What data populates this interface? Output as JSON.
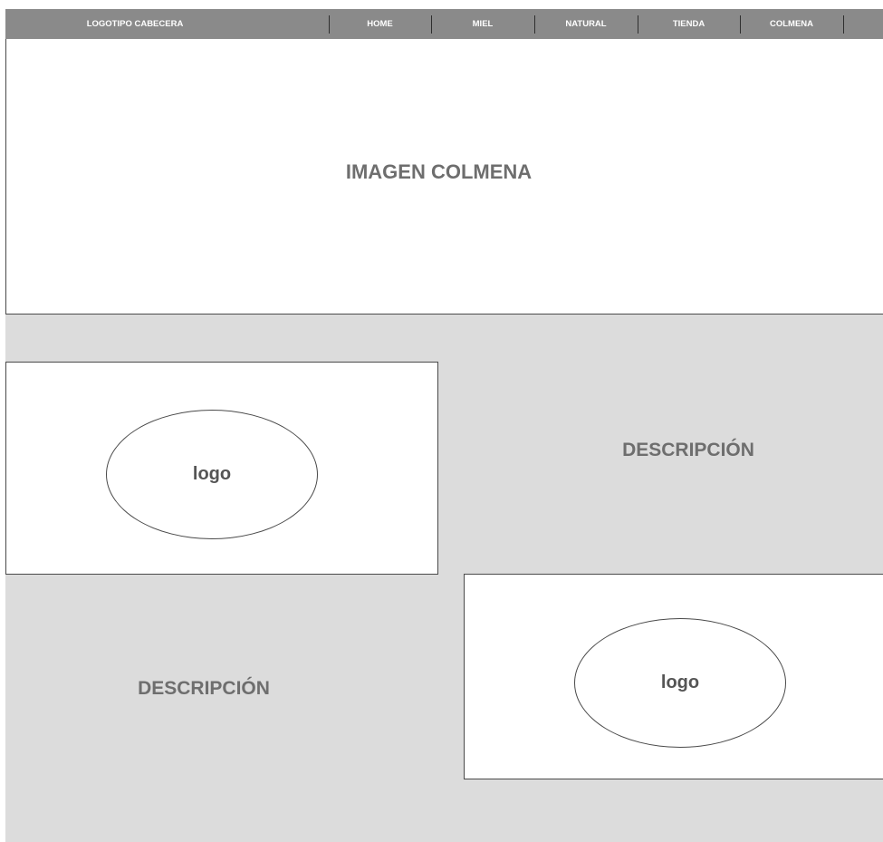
{
  "header": {
    "logo_text": "LOGOTIPO CABECERA",
    "nav": [
      "HOME",
      "MIEL",
      "NATURAL",
      "TIENDA",
      "COLMENA"
    ]
  },
  "hero": {
    "label": "IMAGEN COLMENA"
  },
  "section1": {
    "logo_label": "logo",
    "description": "DESCRIPCIÓN"
  },
  "section2": {
    "logo_label": "logo",
    "description": "DESCRIPCIÓN"
  },
  "colors": {
    "header_bg": "#8a8a8a",
    "content_bg": "#dcdcdc",
    "text_gray": "#6e6e6e",
    "border": "#4a4a4a"
  }
}
